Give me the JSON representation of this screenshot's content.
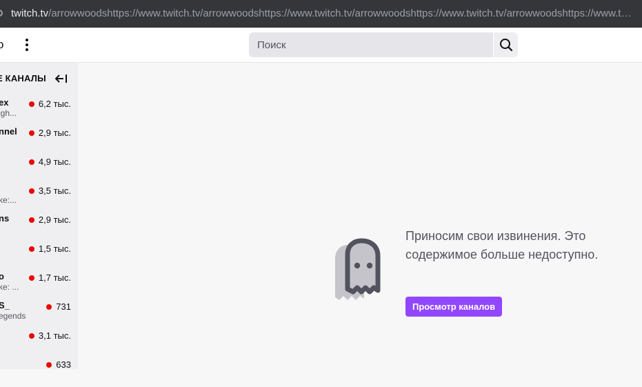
{
  "browser": {
    "url_host": "twitch.tv",
    "url_rest": "/arrowwoodshttps://www.twitch.tv/arrowwoodshttps://www.twitch.tv/arrowwoodshttps://www.twitch.tv/arrowwoodshttps://www.twitch.tv..."
  },
  "topnav": {
    "cut_letter": "о",
    "search_placeholder": "Поиск"
  },
  "sidebar": {
    "header": "Е КАНАЛЫ",
    "channels": [
      {
        "name": "ex",
        "game": "igh...",
        "viewers": "6,2 тыс."
      },
      {
        "name": "nnel",
        "game": "",
        "viewers": "2,9 тыс."
      },
      {
        "name": "",
        "game": "",
        "viewers": "4,9 тыс."
      },
      {
        "name": "",
        "game": "ke:...",
        "viewers": "3,5 тыс."
      },
      {
        "name": "ns",
        "game": "",
        "viewers": "2,9 тыс."
      },
      {
        "name": "",
        "game": "",
        "viewers": "1,5 тыс."
      },
      {
        "name": "о",
        "game": "ke: ...",
        "viewers": "1,7 тыс."
      },
      {
        "name": "S_",
        "game": "egends",
        "viewers": "731"
      },
      {
        "name": "",
        "game": "",
        "viewers": "3,1 тыс."
      },
      {
        "name": "",
        "game": "",
        "viewers": "633"
      }
    ]
  },
  "main": {
    "error_message": "Приносим свои извинения. Это содержимое больше недоступно.",
    "browse_button": "Просмотр каналов"
  },
  "colors": {
    "accent": "#9147ff",
    "live": "#eb0400"
  }
}
